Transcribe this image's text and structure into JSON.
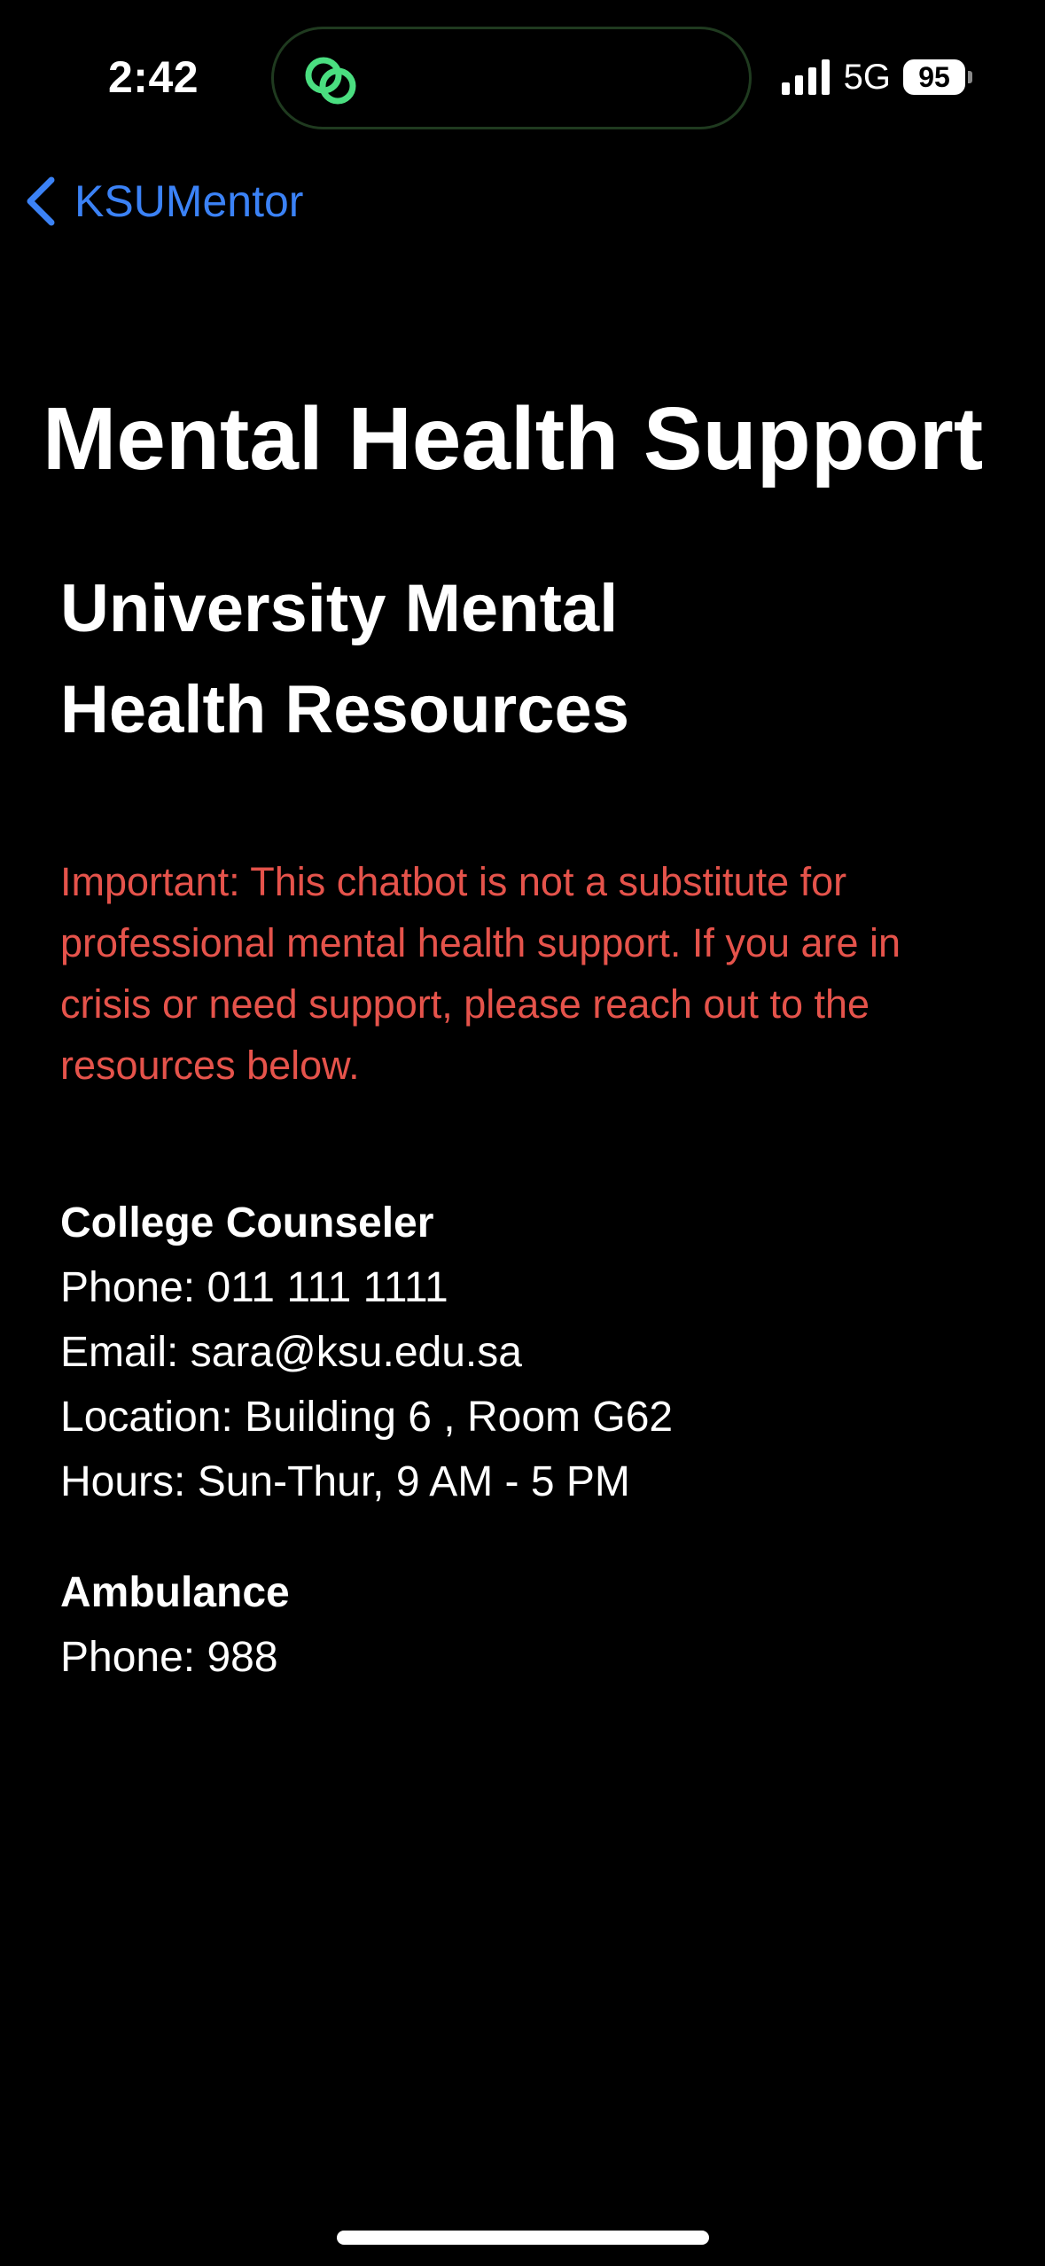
{
  "status_bar": {
    "time": "2:42",
    "network": "5G",
    "battery_level": "95",
    "signal_icon": "cellular-signal-icon",
    "island_icon": "linked-rings-app-icon"
  },
  "nav": {
    "back_label": "KSUMentor",
    "back_icon": "chevron-left-icon"
  },
  "page": {
    "title": "Mental Health Support",
    "section_title": "University Mental Health Resources",
    "disclaimer": "Important: This chatbot is not a substitute for professional mental health support. If you are in crisis or need support, please reach out to the resources below."
  },
  "contacts": {
    "counselor": {
      "name": "College Counseler",
      "phone": "Phone: 011 111 1111",
      "email": "Email: sara@ksu.edu.sa",
      "location": "Location: Building 6 , Room G62",
      "hours": "Hours: Sun-Thur, 9 AM - 5 PM"
    },
    "ambulance": {
      "name": "Ambulance",
      "phone": "Phone: 988"
    }
  },
  "colors": {
    "background": "#000000",
    "accent_blue": "#3b82f6",
    "warning_red": "#e5534b",
    "island_icon_green": "#4ade80",
    "text": "#ffffff"
  }
}
